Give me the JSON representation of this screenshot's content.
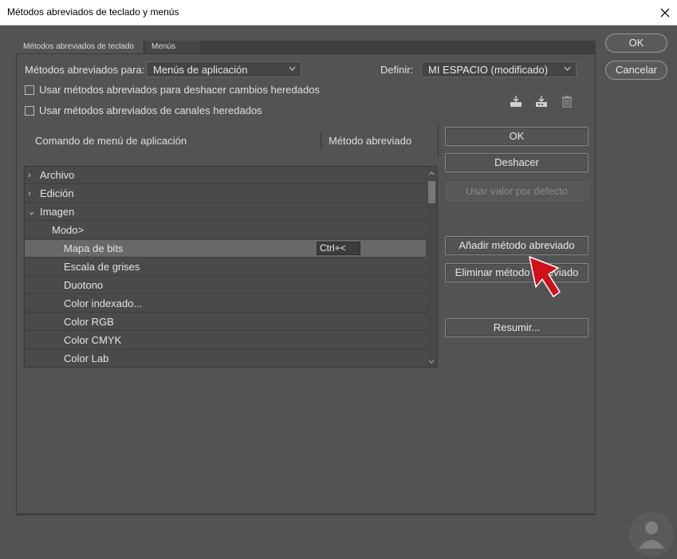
{
  "window": {
    "title": "Métodos abreviados de teclado y menús"
  },
  "tabs": [
    {
      "label": "Métodos abreviados de teclado"
    },
    {
      "label": "Menús"
    }
  ],
  "shortcuts_for": {
    "label": "Métodos abreviados para:",
    "value": "Menús de aplicación"
  },
  "set": {
    "label": "Definir:",
    "value": "MI ESPACIO (modificado)"
  },
  "checkboxes": [
    {
      "label": "Usar métodos abreviados para deshacer cambios heredados",
      "checked": false
    },
    {
      "label": "Usar métodos abreviados de canales heredados",
      "checked": false
    }
  ],
  "set_icons": [
    "save-set-icon",
    "save-as-set-icon",
    "delete-set-icon"
  ],
  "table": {
    "col_command": "Comando de menú de aplicación",
    "col_shortcut": "Método abreviado",
    "rows": [
      {
        "label": "Archivo",
        "expand": "›"
      },
      {
        "label": "Edición",
        "expand": "›"
      },
      {
        "label": "Imagen",
        "expand": "⌄"
      },
      {
        "label": "Modo>",
        "expand": ""
      },
      {
        "label": "Mapa de bits",
        "expand": "",
        "shortcut": "Ctrl+<",
        "selected": true
      },
      {
        "label": "Escala de grises",
        "expand": ""
      },
      {
        "label": "Duotono",
        "expand": ""
      },
      {
        "label": "Color indexado...",
        "expand": ""
      },
      {
        "label": "Color RGB",
        "expand": ""
      },
      {
        "label": "Color CMYK",
        "expand": ""
      },
      {
        "label": "Color Lab",
        "expand": ""
      }
    ]
  },
  "buttons": {
    "ok_inner": "OK",
    "undo": "Deshacer",
    "use_default": "Usar valor por defecto",
    "add_shortcut": "Añadir método abreviado",
    "delete_shortcut": "Eliminar método abreviado",
    "summarize": "Resumir...",
    "ok": "OK",
    "cancel": "Cancelar"
  },
  "colors": {
    "background": "#535353",
    "arrow_red": "#d0101a"
  }
}
